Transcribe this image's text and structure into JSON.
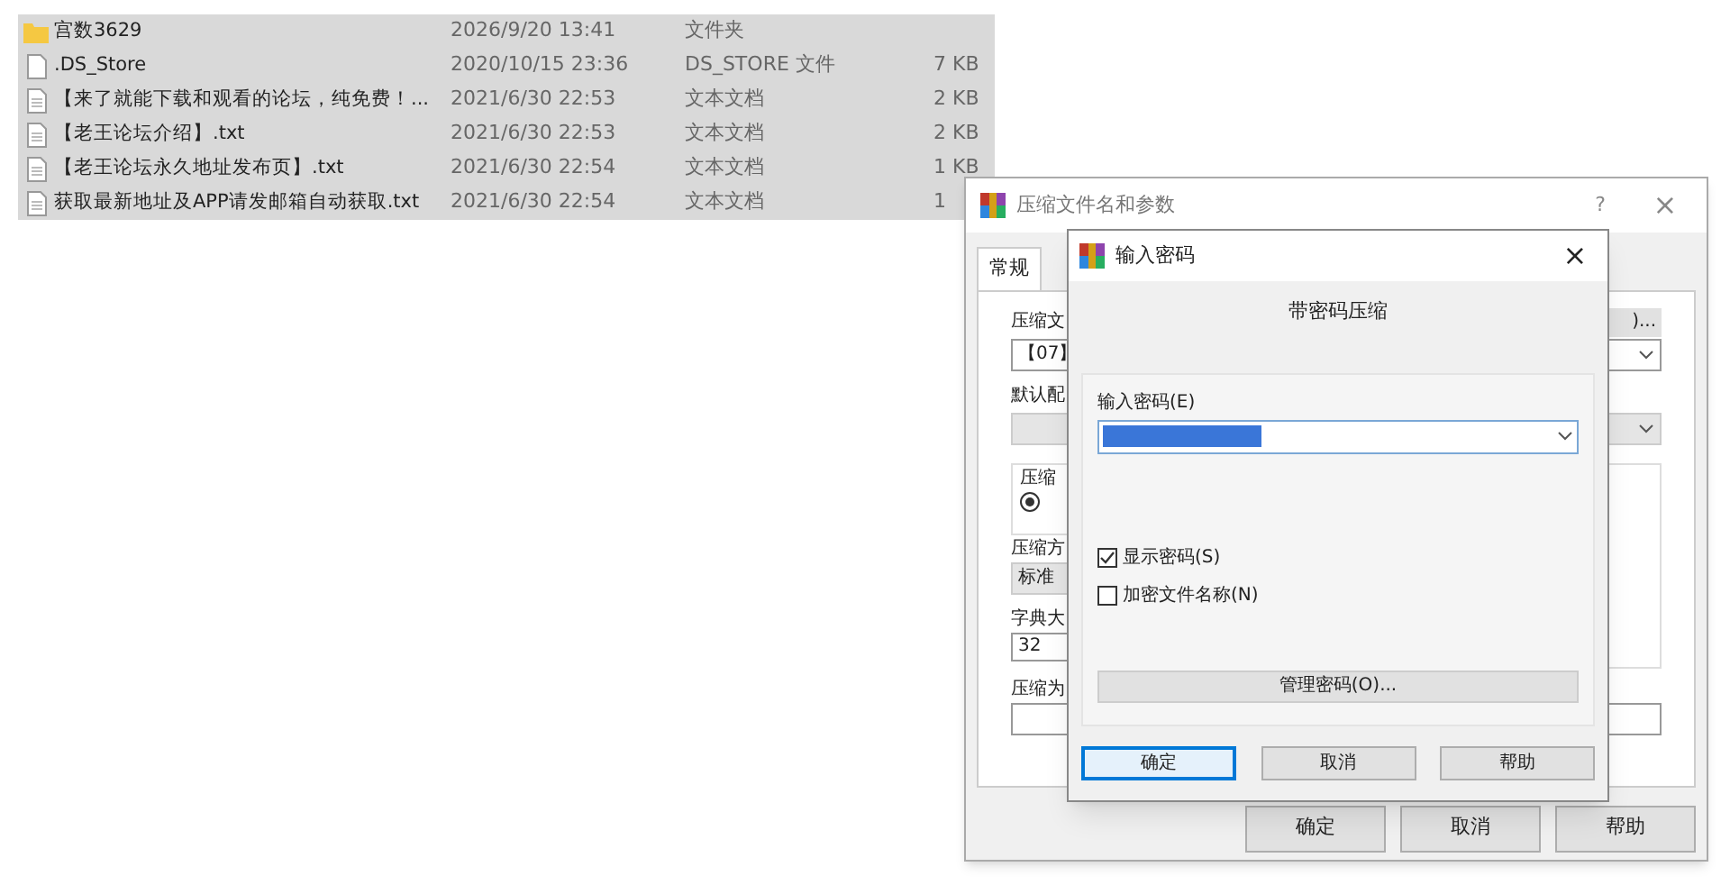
{
  "file_list": {
    "rows": [
      {
        "kind": "folder",
        "name": "宫数3629",
        "date": "2026/9/20 13:41",
        "type": "文件夹",
        "size": ""
      },
      {
        "kind": "file",
        "name": ".DS_Store",
        "date": "2020/10/15 23:36",
        "type": "DS_STORE 文件",
        "size": "7 KB"
      },
      {
        "kind": "text",
        "name": "【来了就能下载和观看的论坛，纯免费！...",
        "date": "2021/6/30 22:53",
        "type": "文本文档",
        "size": "2 KB"
      },
      {
        "kind": "text",
        "name": "【老王论坛介绍】.txt",
        "date": "2021/6/30 22:53",
        "type": "文本文档",
        "size": "2 KB"
      },
      {
        "kind": "text",
        "name": "【老王论坛永久地址发布页】.txt",
        "date": "2021/6/30 22:54",
        "type": "文本文档",
        "size": "1 KB"
      },
      {
        "kind": "text",
        "name": "获取最新地址及APP请发邮箱自动获取.txt",
        "date": "2021/6/30 22:54",
        "type": "文本文档",
        "size": "1"
      }
    ]
  },
  "archive_window": {
    "title": "压缩文件名和参数",
    "help": "?",
    "close": "×",
    "tab": "常规",
    "labels": [
      "压缩文",
      "默认配",
      "压缩",
      "压缩方",
      "字典大",
      "压缩为"
    ],
    "archive_name": "【07】",
    "set_password_button": ")...",
    "method": "标准",
    "dictionary": "32",
    "radio_checked": true,
    "buttons": [
      "确定",
      "取消",
      "帮助"
    ]
  },
  "password_dialog": {
    "title": "输入密码",
    "close": "×",
    "heading": "带密码压缩",
    "password_label": "输入密码(E)",
    "options": [
      {
        "label": "显示密码(S)",
        "checked": true
      },
      {
        "label": "加密文件名称(N)",
        "checked": false
      }
    ],
    "manage_button": "管理密码(O)...",
    "buttons": [
      {
        "label": "确定",
        "selected": true
      },
      {
        "label": "取消",
        "selected": false
      },
      {
        "label": "帮助",
        "selected": false
      }
    ]
  }
}
